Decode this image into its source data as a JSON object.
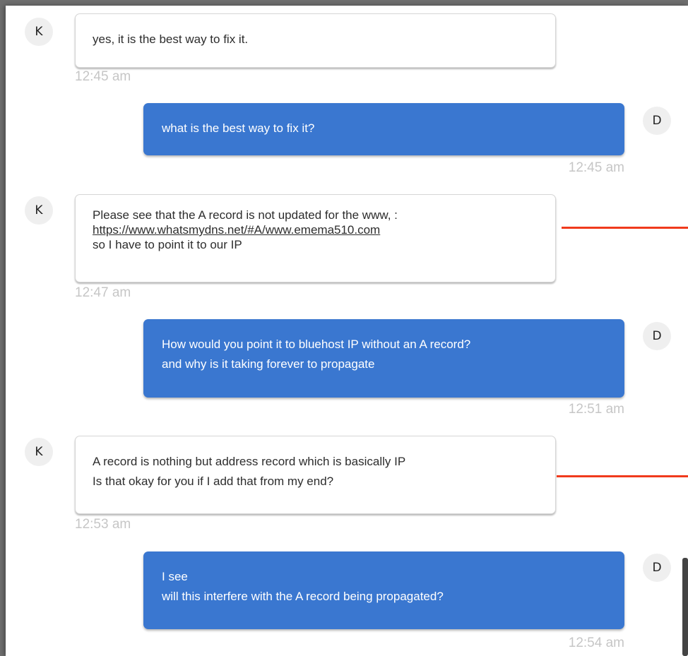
{
  "messages": [
    {
      "sender": "K",
      "lines": [
        "yes, it is the best way to fix it."
      ],
      "time": "12:45 am"
    },
    {
      "sender": "D",
      "lines": [
        "what is the best way to fix it?"
      ],
      "time": "12:45 am"
    },
    {
      "sender": "K",
      "lines": [
        "Please see that the A record is not updated for the www, :",
        "https://www.whatsmydns.net/#A/www.emema510.com",
        "so I have to point it to our IP"
      ],
      "time": "12:47 am"
    },
    {
      "sender": "D",
      "lines": [
        "How would you point it to bluehost IP without an A record?",
        "and why is it taking forever to propagate"
      ],
      "time": "12:51 am"
    },
    {
      "sender": "K",
      "lines": [
        "A record is nothing but address record which is basically IP",
        "Is that okay for you if I add that from my end?"
      ],
      "time": "12:53 am"
    },
    {
      "sender": "D",
      "lines": [
        "I see",
        "will this interfere with the A record being propagated?"
      ],
      "time": "12:54 am"
    }
  ],
  "colors": {
    "outgoing_bubble": "#3a77d0",
    "incoming_bubble": "#ffffff",
    "annotation_line": "#f03a1c",
    "timestamp": "#c6c6c6"
  }
}
